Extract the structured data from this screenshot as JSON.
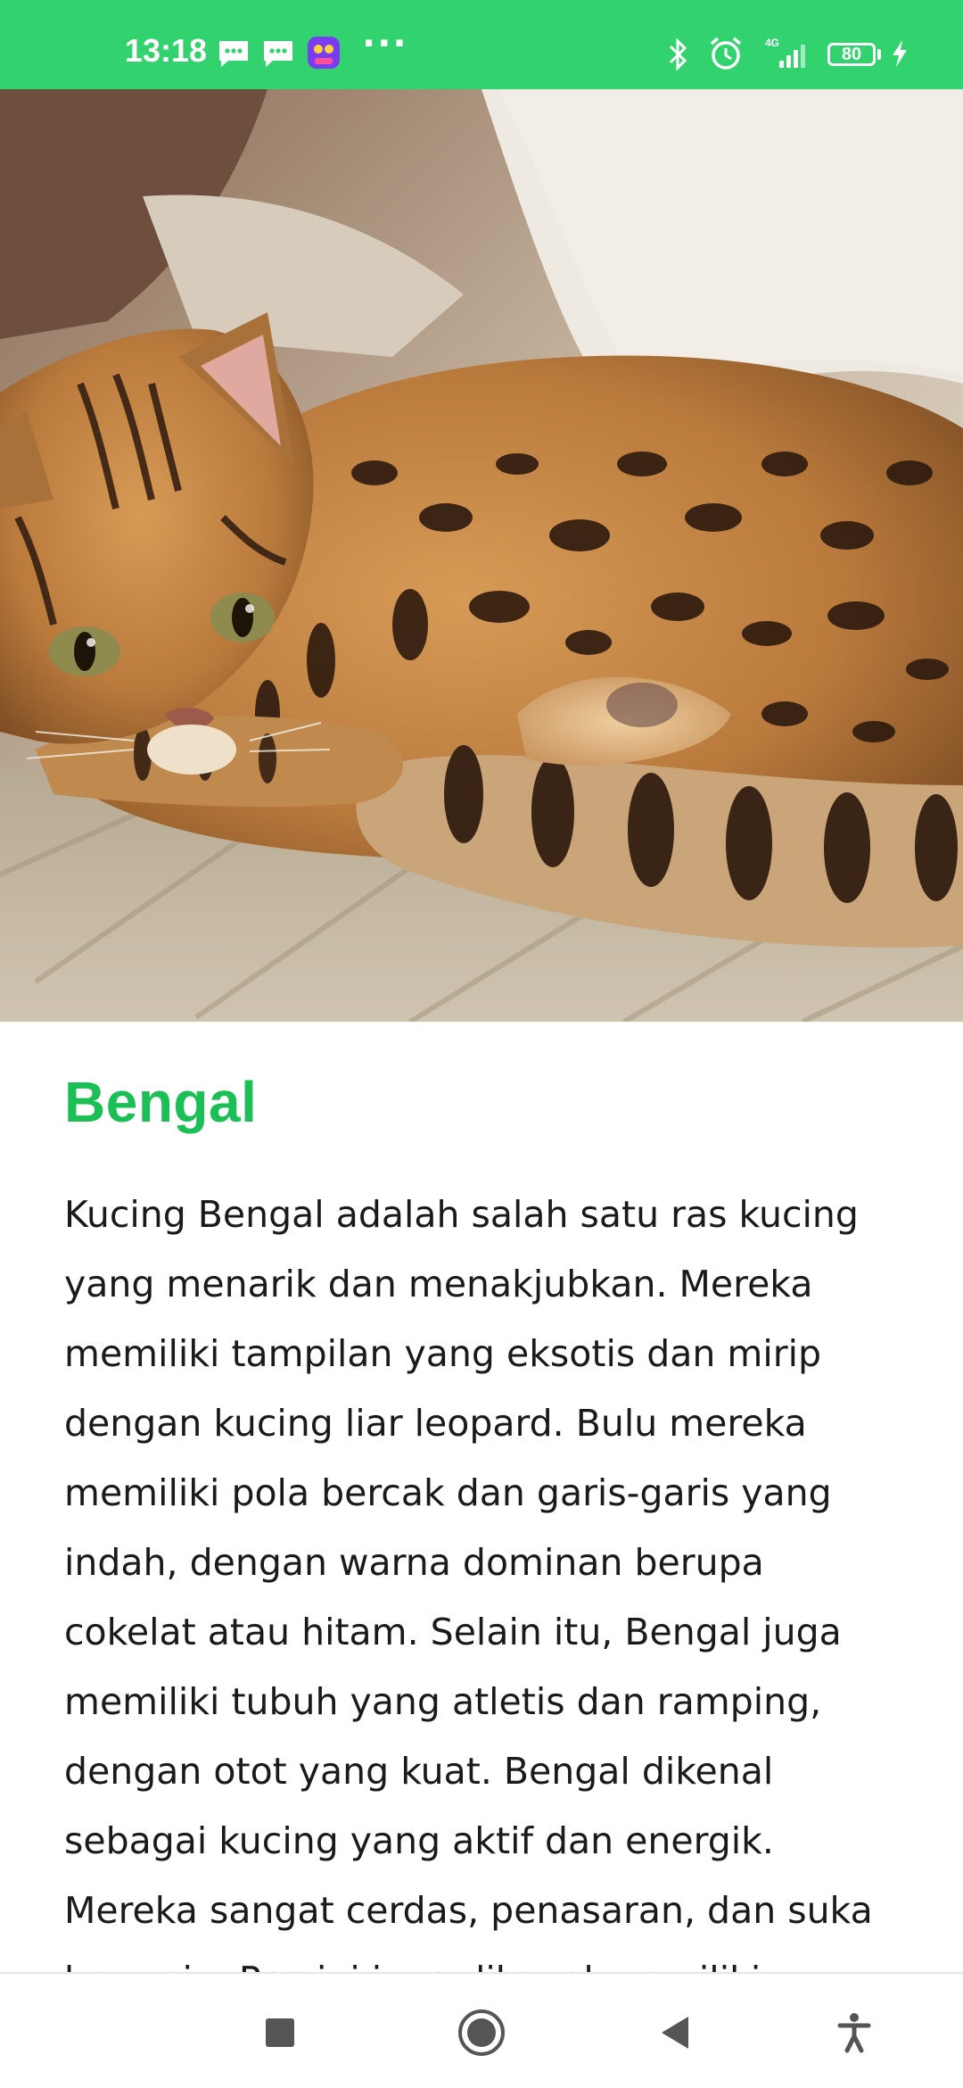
{
  "status_bar": {
    "time": "13:18",
    "network": "4G",
    "battery": "80",
    "accent_color": "#32d26f",
    "icons": [
      "message-icon",
      "message-icon",
      "app-badge-icon",
      "more-dots-icon",
      "bluetooth-icon",
      "alarm-icon",
      "signal-icon",
      "battery-icon",
      "charging-icon"
    ]
  },
  "hero": {
    "image_icon": "bengal-cat-photo"
  },
  "article": {
    "title": "Bengal",
    "title_color": "#1bbf55",
    "body": "Kucing Bengal adalah salah satu ras kucing yang menarik dan menakjubkan. Mereka memiliki tampilan yang eksotis dan mirip dengan kucing liar leopard. Bulu mereka memiliki pola bercak dan garis-garis yang indah, dengan warna dominan berupa cokelat atau hitam. Selain itu, Bengal juga memiliki tubuh yang atletis dan ramping, dengan otot yang kuat. Bengal dikenal sebagai kucing yang aktif dan energik. Mereka sangat cerdas, penasaran, dan suka bermain. Ras ini juga dikenal memiliki"
  },
  "nav_bar": {
    "buttons": [
      "recents-square-icon",
      "home-circle-icon",
      "back-triangle-icon",
      "accessibility-icon"
    ]
  }
}
